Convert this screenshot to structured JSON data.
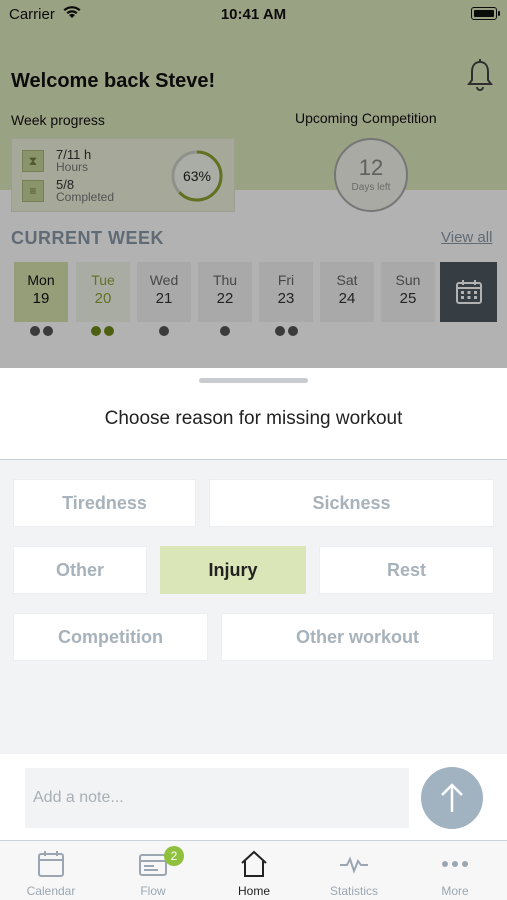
{
  "status_bar": {
    "carrier": "Carrier",
    "time": "10:41 AM"
  },
  "home": {
    "welcome": "Welcome back Steve!",
    "week_progress": {
      "title": "Week progress",
      "hours_value": "7/11 h",
      "hours_label": "Hours",
      "completed_value": "5/8",
      "completed_label": "Completed",
      "percent_label": "63%",
      "percent": 0.63
    },
    "upcoming": {
      "title": "Upcoming Competition",
      "days": "12",
      "days_label": "Days left"
    },
    "current_week": {
      "title": "CURRENT WEEK",
      "view_all": "View all"
    },
    "days": [
      {
        "name": "Mon",
        "num": "19"
      },
      {
        "name": "Tue",
        "num": "20"
      },
      {
        "name": "Wed",
        "num": "21"
      },
      {
        "name": "Thu",
        "num": "22"
      },
      {
        "name": "Fri",
        "num": "23"
      },
      {
        "name": "Sat",
        "num": "24"
      },
      {
        "name": "Sun",
        "num": "25"
      }
    ]
  },
  "sheet": {
    "title": "Choose reason for missing workout",
    "reasons": [
      {
        "label": "Tiredness",
        "selected": false
      },
      {
        "label": "Sickness",
        "selected": false
      },
      {
        "label": "Other",
        "selected": false
      },
      {
        "label": "Injury",
        "selected": true
      },
      {
        "label": "Rest",
        "selected": false
      },
      {
        "label": "Competition",
        "selected": false
      },
      {
        "label": "Other workout",
        "selected": false
      }
    ],
    "note_placeholder": "Add a note..."
  },
  "tabs": [
    {
      "label": "Calendar",
      "icon": "calendar-icon",
      "active": false
    },
    {
      "label": "Flow",
      "icon": "flow-icon",
      "active": false,
      "badge": "2"
    },
    {
      "label": "Home",
      "icon": "home-icon",
      "active": true
    },
    {
      "label": "Statistics",
      "icon": "statistics-icon",
      "active": false
    },
    {
      "label": "More",
      "icon": "more-icon",
      "active": false
    }
  ],
  "colors": {
    "header_green": "#dde8bd",
    "selected_reason": "#dbe6b8",
    "send_button": "#a1b2c1",
    "badge_green": "#8fc13e",
    "muted_text": "#a7b2bb"
  }
}
